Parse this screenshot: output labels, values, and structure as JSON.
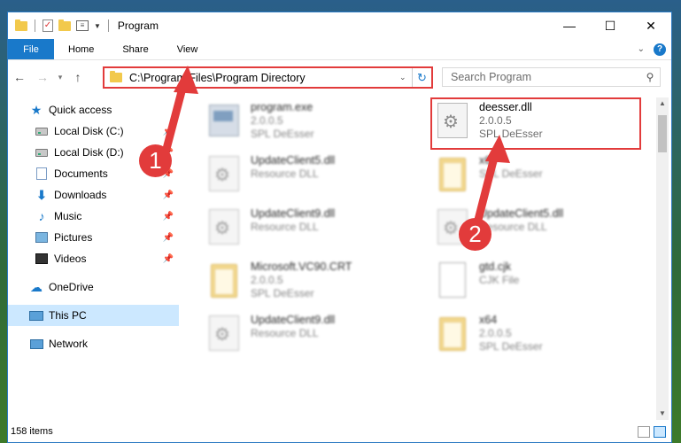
{
  "window": {
    "title": "Program",
    "controls": {
      "minimize": "—",
      "maximize": "☐",
      "close": "✕"
    }
  },
  "ribbon": {
    "file_tab": "File",
    "tabs": [
      "Home",
      "Share",
      "View"
    ],
    "help": "?"
  },
  "nav": {
    "address": "C:\\Program Files\\Program Directory",
    "search_placeholder": "Search Program"
  },
  "sidebar": {
    "items": [
      {
        "label": "Quick access",
        "icon": "star-icon",
        "pinned": false
      },
      {
        "label": "Local Disk (C:)",
        "icon": "drive-icon",
        "pinned": true
      },
      {
        "label": "Local Disk (D:)",
        "icon": "drive-icon",
        "pinned": true
      },
      {
        "label": "Documents",
        "icon": "documents-icon",
        "pinned": true
      },
      {
        "label": "Downloads",
        "icon": "downloads-icon",
        "pinned": true
      },
      {
        "label": "Music",
        "icon": "music-icon",
        "pinned": true
      },
      {
        "label": "Pictures",
        "icon": "pictures-icon",
        "pinned": true
      },
      {
        "label": "Videos",
        "icon": "videos-icon",
        "pinned": true
      },
      {
        "label": "OneDrive",
        "icon": "onedrive-icon",
        "pinned": false
      },
      {
        "label": "This PC",
        "icon": "this-pc-icon",
        "pinned": false,
        "selected": true
      },
      {
        "label": "Network",
        "icon": "network-icon",
        "pinned": false
      }
    ]
  },
  "files": [
    {
      "name": "program.exe",
      "line2": "2.0.0.5",
      "line3": "SPL DeEsser",
      "icon": "exe-icon",
      "blurred": true
    },
    {
      "name": "deesser.dll",
      "line2": "2.0.0.5",
      "line3": "SPL DeEsser",
      "icon": "dll-icon",
      "blurred": false,
      "highlighted": true
    },
    {
      "name": "UpdateClient5.dll",
      "line2": "Resource DLL",
      "line3": "",
      "icon": "dll-icon",
      "blurred": true
    },
    {
      "name": "x64",
      "line2": "",
      "line3": "SPL DeEsser",
      "icon": "folder-icon",
      "blurred": true
    },
    {
      "name": "UpdateClient9.dll",
      "line2": "Resource DLL",
      "line3": "",
      "icon": "dll-icon",
      "blurred": true
    },
    {
      "name": "UpdateClient5.dll",
      "line2": "Resource DLL",
      "line3": "",
      "icon": "dll-icon",
      "blurred": true
    },
    {
      "name": "Microsoft.VC90.CRT",
      "line2": "2.0.0.5",
      "line3": "SPL DeEsser",
      "icon": "folder-icon",
      "blurred": true
    },
    {
      "name": "gtd.cjk",
      "line2": "CJK File",
      "line3": "",
      "icon": "document-icon",
      "blurred": true
    },
    {
      "name": "UpdateClient9.dll",
      "line2": "Resource DLL",
      "line3": "",
      "icon": "dll-icon",
      "blurred": true
    },
    {
      "name": "x64",
      "line2": "2.0.0.5",
      "line3": "SPL DeEsser",
      "icon": "folder-icon",
      "blurred": true
    }
  ],
  "status": {
    "items_count": "158 items"
  },
  "annotations": {
    "badge1": "1",
    "badge2": "2",
    "color": "#e23b3b"
  }
}
